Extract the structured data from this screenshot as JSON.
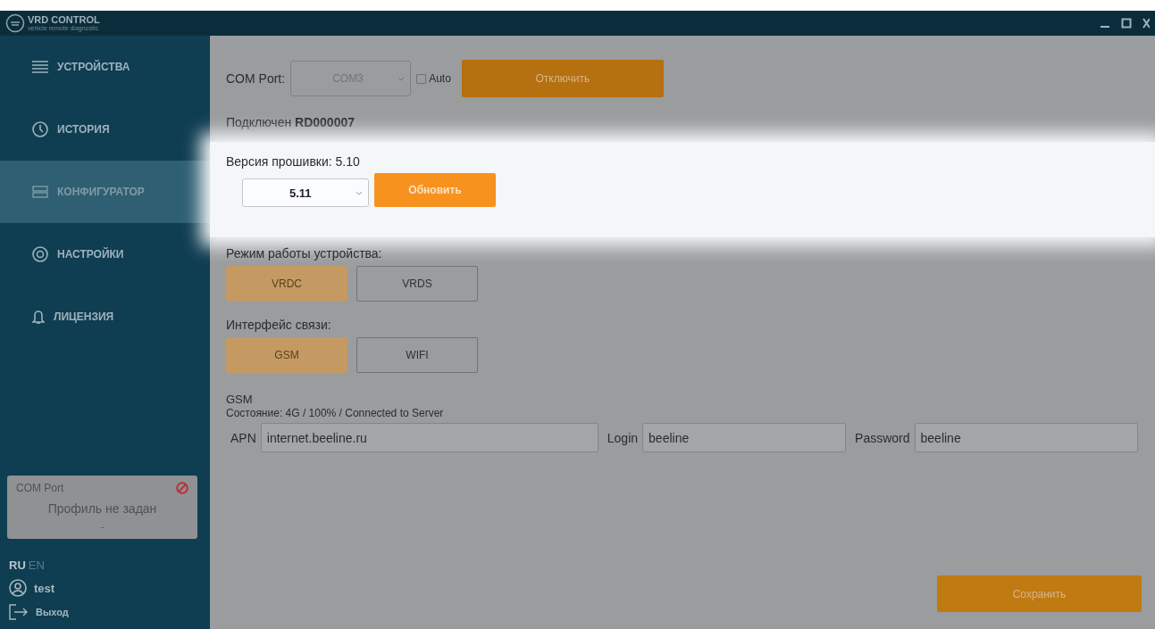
{
  "window": {
    "logo": "VRD CONTROL",
    "logo_subtitle": "vehicle remote diagnostic"
  },
  "sidebar": {
    "items": [
      {
        "label": "УСТРОЙСТВА",
        "kind": "list",
        "selected": false
      },
      {
        "label": "ИСТОРИЯ",
        "kind": "clock",
        "selected": false
      },
      {
        "label": "КОНФИГУРАТОР",
        "kind": "config",
        "selected": true
      },
      {
        "label": "НАСТРОЙКИ",
        "kind": "gear",
        "selected": false
      },
      {
        "label": "ЛИЦЕНЗИЯ",
        "kind": "bell",
        "selected": false
      }
    ]
  },
  "com_card": {
    "title": "COM Port",
    "error": true,
    "profile": "Профиль не задан",
    "value": "-"
  },
  "languages": [
    {
      "label": "RU",
      "selected": true
    },
    {
      "label": "EN",
      "selected": false
    }
  ],
  "user": "test",
  "logout": "Выход",
  "connection": {
    "label": "COM Port:",
    "port": "COM3",
    "port_disabled": true,
    "auto": {
      "label": "Auto",
      "checked": false
    },
    "disconnect": "Отключить",
    "status": "Подключен **RD000007**"
  },
  "firmware": {
    "highlighted": true,
    "label": "Версия прошивки: 5.10",
    "version": "5.11",
    "update": "Обновить"
  },
  "mode": {
    "label": "Режим работы устройства:",
    "options": [
      {
        "label": "VRDC",
        "selected": true
      },
      {
        "label": "VRDS",
        "selected": false
      }
    ]
  },
  "interface": {
    "label": "Интерфейс связи:",
    "options": [
      {
        "label": "GSM",
        "selected": true
      },
      {
        "label": "WIFI",
        "selected": false
      }
    ]
  },
  "gsm": {
    "title": "GSM",
    "status": "Состояние: 4G / 100% / Connected to Server",
    "fields": [
      {
        "label": "APN",
        "value": "internet.beeline.ru"
      },
      {
        "label": "Login",
        "value": "beeline"
      },
      {
        "label": "Password",
        "value": "beeline"
      }
    ]
  },
  "save": "Сохранить"
}
